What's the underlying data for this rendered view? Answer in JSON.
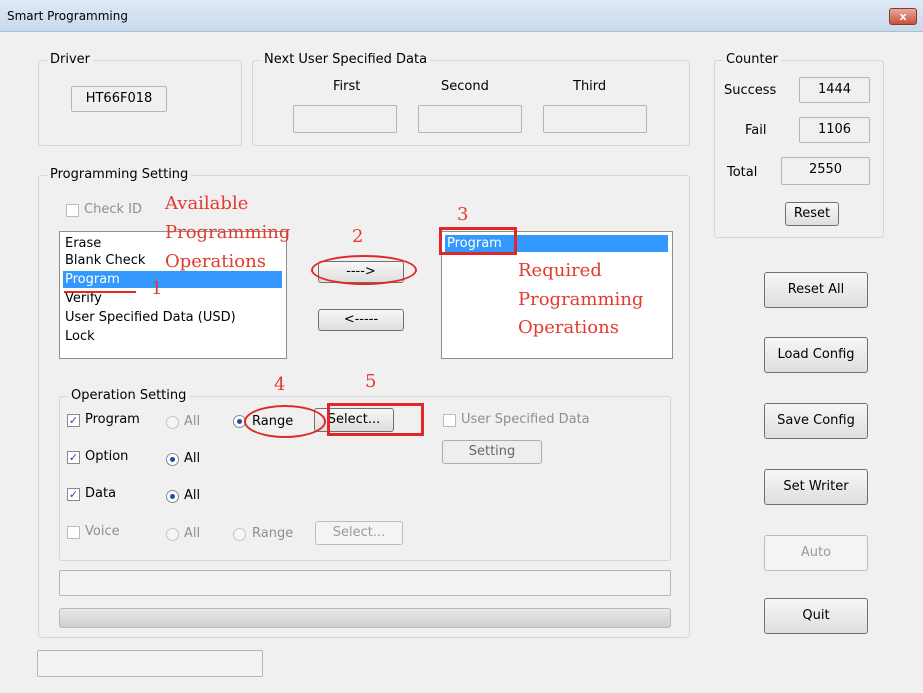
{
  "window": {
    "title": "Smart Programming",
    "close_label": "x"
  },
  "driver": {
    "legend": "Driver",
    "value": "HT66F018"
  },
  "next_user_data": {
    "legend": "Next User Specified Data",
    "first_label": "First",
    "second_label": "Second",
    "third_label": "Third",
    "first_value": "",
    "second_value": "",
    "third_value": ""
  },
  "counter": {
    "legend": "Counter",
    "success_label": "Success",
    "success_value": "1444",
    "fail_label": "Fail",
    "fail_value": "1106",
    "total_label": "Total",
    "total_value": "2550",
    "reset_label": "Reset"
  },
  "programming_setting": {
    "legend": "Programming Setting",
    "check_id_label": "Check ID",
    "available": [
      "Erase",
      "Blank Check",
      "Program",
      "Verify",
      "User Specified Data (USD)",
      "Lock"
    ],
    "available_selected": "Program",
    "required": [
      "Program"
    ],
    "add_label": "---->",
    "remove_label": "<-----"
  },
  "operation_setting": {
    "legend": "Operation Setting",
    "program_label": "Program",
    "option_label": "Option",
    "data_label": "Data",
    "voice_label": "Voice",
    "all_label": "All",
    "range_label": "Range",
    "select_label": "Select...",
    "usd_label": "User Specified Data",
    "setting_label": "Setting",
    "program_checked": true,
    "option_checked": true,
    "data_checked": true,
    "voice_checked": false,
    "program_mode": "Range"
  },
  "buttons": {
    "reset_all": "Reset All",
    "load_config": "Load Config",
    "save_config": "Save Config",
    "set_writer": "Set Writer",
    "auto": "Auto",
    "quit": "Quit"
  },
  "status": {
    "text": ""
  },
  "annotations": {
    "available_ops": [
      "Available",
      "Programming",
      "Operations"
    ],
    "required_ops": [
      "Required",
      "Programming",
      "Operations"
    ],
    "step1": "1",
    "step2": "2",
    "step3": "3",
    "step4": "4",
    "step5": "5",
    "color": "#e23a2e"
  },
  "colors": {
    "selection": "#3399ff",
    "annotation_box": "#e0282a"
  }
}
